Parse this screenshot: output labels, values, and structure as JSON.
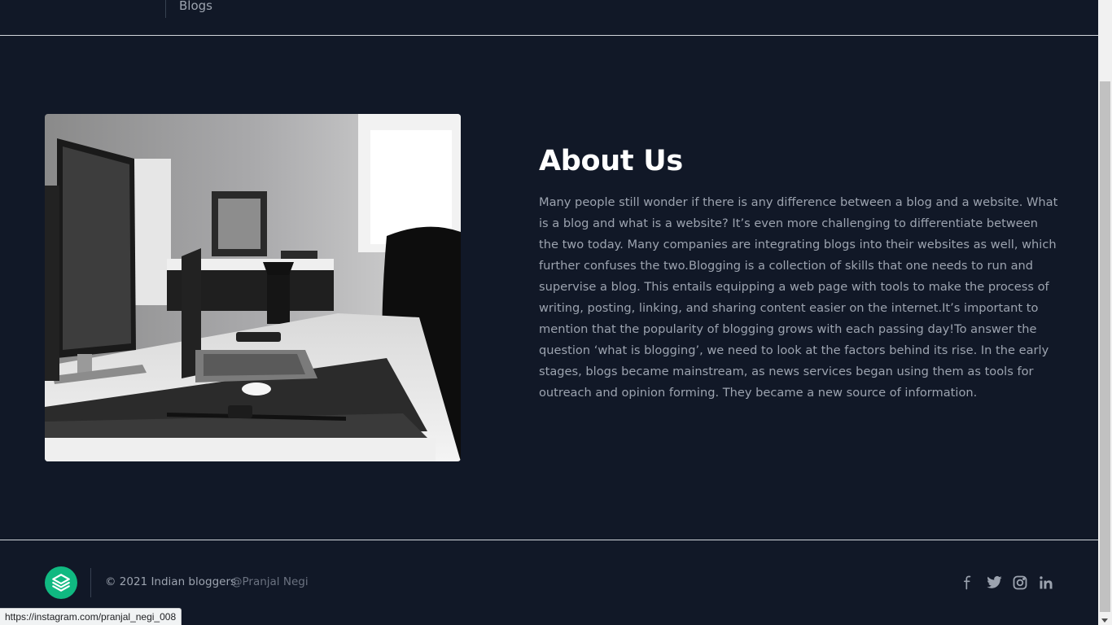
{
  "header": {
    "nav_link": "Blogs"
  },
  "about": {
    "title": "About Us",
    "body": "Many people still wonder if there is any difference between a blog and a website. What is a blog and what is a website? It’s even more challenging to differentiate between the two today. Many companies are integrating blogs into their websites as well, which further confuses the two.Blogging is a collection of skills that one needs to run and supervise a blog. This entails equipping a web page with tools to make the process of writing, posting, linking, and sharing content easier on the internet.It’s important to mention that the popularity of blogging grows with each passing day!To answer the question ‘what is blogging’, we need to look at the factors behind its rise. In the early stages, blogs became mainstream, as news services began using them as tools for outreach and opinion forming. They became a new source of information."
  },
  "footer": {
    "copyright": "© 2021 Indian bloggers",
    "handle": "@Pranjal Negi",
    "logo_icon": "layers-icon",
    "social_icons": [
      "facebook-icon",
      "twitter-icon",
      "instagram-icon",
      "linkedin-icon"
    ]
  },
  "status_bar": {
    "url": "https://instagram.com/pranjal_negi_008"
  },
  "colors": {
    "background": "#111827",
    "accent": "#10b981",
    "title": "#ffffff",
    "body_text": "#9ca3af"
  }
}
